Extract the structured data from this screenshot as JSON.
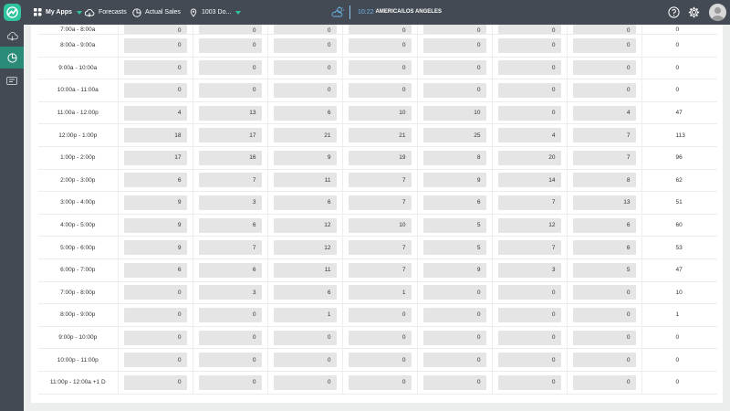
{
  "topbar": {
    "my_apps": "My Apps",
    "forecasts": "Forecasts",
    "actual_sales": "Actual Sales",
    "location": "1003 Do...",
    "time": "10:22",
    "timezone": "AMERICA/LOS ANGELES"
  },
  "colors": {
    "accent": "#2ec4a0",
    "topbar": "#434a53",
    "active_sidebar": "#2a8b78",
    "clock": "#6cb6e8"
  },
  "icons": [
    "logo-icon",
    "grid-icon",
    "cloud-icon",
    "pie-chart-icon",
    "location-icon",
    "weather-icon",
    "help-icon",
    "gear-icon",
    "avatar",
    "ticket-icon"
  ],
  "table": {
    "rows": [
      {
        "label": "7:00a - 8:00a",
        "values": [
          "0",
          "0",
          "0",
          "0",
          "0",
          "0",
          "0"
        ],
        "total": "0"
      },
      {
        "label": "8:00a - 9:00a",
        "values": [
          "0",
          "0",
          "0",
          "0",
          "0",
          "0",
          "0"
        ],
        "total": "0"
      },
      {
        "label": "9:00a - 10:00a",
        "values": [
          "0",
          "0",
          "0",
          "0",
          "0",
          "0",
          "0"
        ],
        "total": "0"
      },
      {
        "label": "10:00a - 11:00a",
        "values": [
          "0",
          "0",
          "0",
          "0",
          "0",
          "0",
          "0"
        ],
        "total": "0"
      },
      {
        "label": "11:00a - 12:00p",
        "values": [
          "4",
          "13",
          "6",
          "10",
          "10",
          "0",
          "4"
        ],
        "total": "47"
      },
      {
        "label": "12:00p - 1:00p",
        "values": [
          "18",
          "17",
          "21",
          "21",
          "25",
          "4",
          "7"
        ],
        "total": "113"
      },
      {
        "label": "1:00p - 2:00p",
        "values": [
          "17",
          "16",
          "9",
          "19",
          "8",
          "20",
          "7"
        ],
        "total": "96"
      },
      {
        "label": "2:00p - 3:00p",
        "values": [
          "6",
          "7",
          "11",
          "7",
          "9",
          "14",
          "8"
        ],
        "total": "62"
      },
      {
        "label": "3:00p - 4:00p",
        "values": [
          "9",
          "3",
          "6",
          "7",
          "6",
          "7",
          "13"
        ],
        "total": "51"
      },
      {
        "label": "4:00p - 5:00p",
        "values": [
          "9",
          "6",
          "12",
          "10",
          "5",
          "12",
          "6"
        ],
        "total": "60"
      },
      {
        "label": "5:00p - 6:00p",
        "values": [
          "9",
          "7",
          "12",
          "7",
          "5",
          "7",
          "6"
        ],
        "total": "53"
      },
      {
        "label": "6:00p - 7:00p",
        "values": [
          "6",
          "6",
          "11",
          "7",
          "9",
          "3",
          "5"
        ],
        "total": "47"
      },
      {
        "label": "7:00p - 8:00p",
        "values": [
          "0",
          "3",
          "6",
          "1",
          "0",
          "0",
          "0"
        ],
        "total": "10"
      },
      {
        "label": "8:00p - 9:00p",
        "values": [
          "0",
          "0",
          "1",
          "0",
          "0",
          "0",
          "0"
        ],
        "total": "1"
      },
      {
        "label": "9:00p - 10:00p",
        "values": [
          "0",
          "0",
          "0",
          "0",
          "0",
          "0",
          "0"
        ],
        "total": "0"
      },
      {
        "label": "10:00p - 11:00p",
        "values": [
          "0",
          "0",
          "0",
          "0",
          "0",
          "0",
          "0"
        ],
        "total": "0"
      },
      {
        "label": "11:00p - 12:00a +1 D",
        "values": [
          "0",
          "0",
          "0",
          "0",
          "0",
          "0",
          "0"
        ],
        "total": "0"
      }
    ]
  }
}
